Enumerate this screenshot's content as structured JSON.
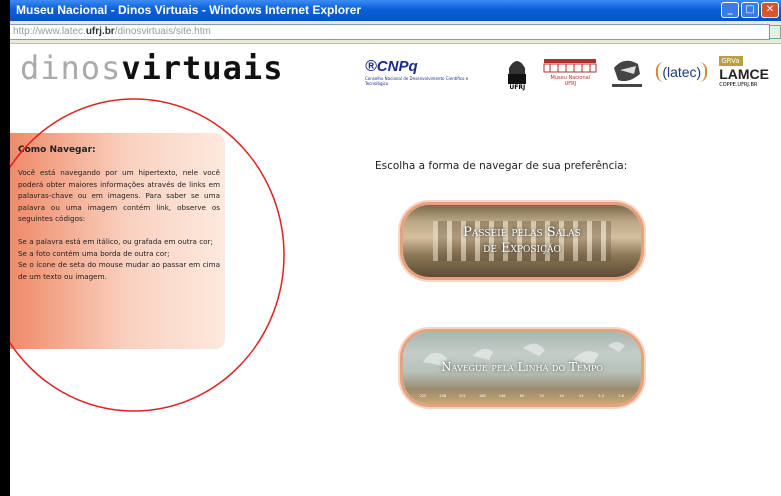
{
  "window": {
    "title": "Museu Nacional - Dinos Virtuais - Windows Internet Explorer",
    "address_grey_prefix": "http://www.latec.",
    "address_domain": "ufrj.br",
    "address_suffix": "/dinosvirtuais/site.htm"
  },
  "logo": {
    "light_part": "dinos",
    "dark_part": "virtuais"
  },
  "sponsors": {
    "cnpq": "CNPq",
    "cnpq_sub": "Conselho Nacional de Desenvolvimento Científico e Tecnológico",
    "ufrj": "UFRJ",
    "museu": "Museu Nacional",
    "museu_sub": "UFRJ",
    "latec": "(latec)",
    "grva": "GRVa",
    "lamce": "LAMCE",
    "lamce_sub": "COPPE.UFRJ.BR"
  },
  "sidebar": {
    "title": "Como Navegar:",
    "paragraph1": "Você está navegando por um hipertexto, nele você poderá obter maiores informações através de links em palavras-chave ou em imagens. Para saber se uma palavra ou uma imagem contém link, observe os seguintes códigos:",
    "line1": "Se a palavra está em itálico, ou grafada em outra cor;",
    "line2": "Se a foto contém uma borda de outra cor;",
    "line3": "Se o ícone de seta do mouse mudar ao passar em cima de um texto ou imagem."
  },
  "main": {
    "choose_text": "Escolha a forma de navegar de sua preferência:",
    "button1_line1": "Passeie pelas Salas",
    "button1_line2": "de Exposição",
    "button2_label": "Navegue pela Linha do Tempo",
    "timeline_labels": [
      "225",
      "208",
      "201",
      "180",
      "146",
      "65",
      "55",
      "34",
      "24",
      "5.3",
      "1.8"
    ]
  },
  "colors": {
    "titlebar": "#0a5fd8",
    "sidebar_orange": "#ef8b69",
    "annotation_red": "#e02020",
    "button_border": "#e7a17f"
  }
}
